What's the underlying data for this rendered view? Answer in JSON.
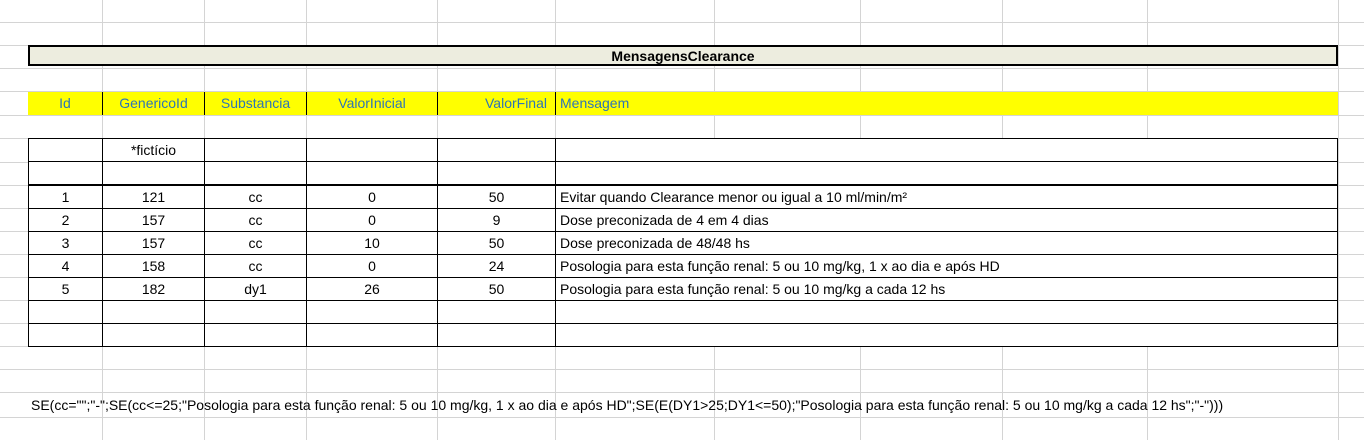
{
  "sheet": {
    "title": "MensagensClearance",
    "headers": [
      "Id",
      "GenericoId",
      "Substancia",
      "ValorInicial",
      "ValorFinal",
      "Mensagem"
    ],
    "note_row": [
      "",
      "*fictício",
      "",
      "",
      "",
      ""
    ],
    "rows": [
      [
        "1",
        "121",
        "cc",
        "0",
        "50",
        "Evitar quando Clearance menor ou igual a 10 ml/min/m²"
      ],
      [
        "2",
        "157",
        "cc",
        "0",
        "9",
        "Dose preconizada de 4 em 4 dias"
      ],
      [
        "3",
        "157",
        "cc",
        "10",
        "50",
        "Dose preconizada de 48/48 hs"
      ],
      [
        "4",
        "158",
        "cc",
        "0",
        "24",
        "Posologia para esta função renal: 5 ou 10 mg/kg, 1 x ao dia e após HD"
      ],
      [
        "5",
        "182",
        "dy1",
        "26",
        "50",
        "Posologia para esta função renal: 5 ou 10 mg/kg a cada 12 hs"
      ]
    ],
    "formula": "SE(cc=\"\";\"-\";SE(cc<=25;\"Posologia para esta função renal: 5 ou 10 mg/kg, 1 x ao dia e após HD\";SE(E(DY1>25;DY1<=50);\"Posologia para esta função renal: 5 ou 10 mg/kg a cada 12 hs\";\"-\")))"
  },
  "colors": {
    "header_fill": "#ffff00",
    "header_text": "#2e75b6",
    "title_fill": "#ededdf",
    "gridline": "#d4d4d4"
  }
}
